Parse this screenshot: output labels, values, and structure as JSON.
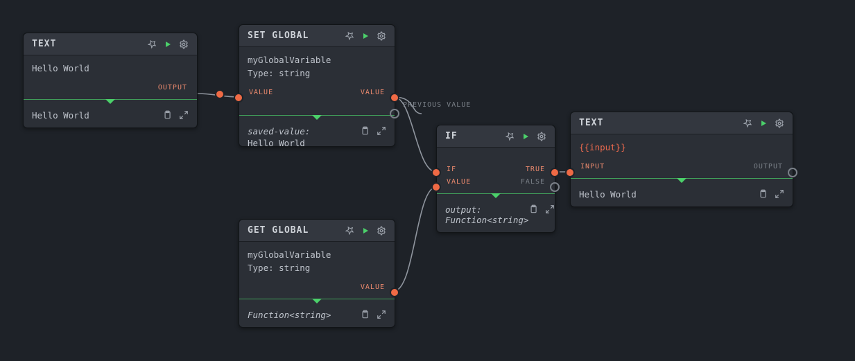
{
  "labels": {
    "output": "OUTPUT",
    "value": "VALUE",
    "prev": "PREVIOUS VALUE",
    "if": "IF",
    "true": "TRUE",
    "false": "FALSE",
    "input": "INPUT"
  },
  "nodes": {
    "text1": {
      "title": "TEXT",
      "body": "Hello World",
      "footer": "Hello World"
    },
    "setg": {
      "title": "SET GLOBAL",
      "l1": "myGlobalVariable",
      "l2": "Type: string",
      "footerLabel": "saved-value:",
      "footerValue": "Hello World"
    },
    "getg": {
      "title": "GET GLOBAL",
      "l1": "myGlobalVariable",
      "l2": "Type: string",
      "footer": "Function<string>"
    },
    "ifn": {
      "title": "IF",
      "footerLabel": "output:",
      "footerValue": "Function<string>"
    },
    "text2": {
      "title": "TEXT",
      "body": "{{input}}",
      "footer": "Hello World"
    }
  }
}
